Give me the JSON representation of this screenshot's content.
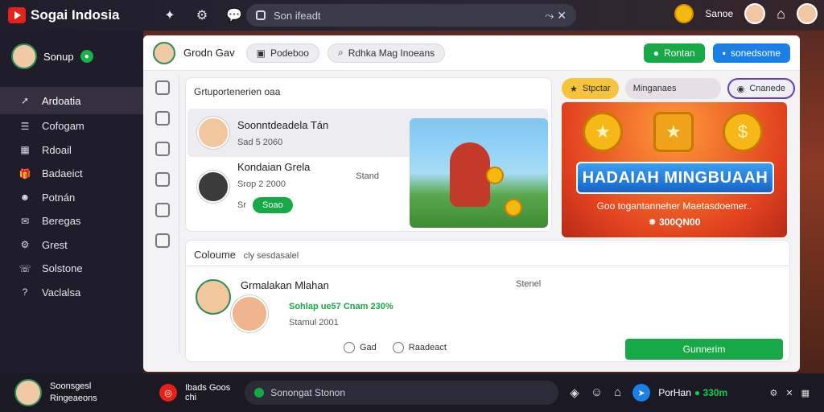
{
  "app": {
    "brand_name": "Sogai Indosia",
    "search_placeholder": "Son ifeadt",
    "coin_label": "Sanoe",
    "colors": {
      "accent_green": "#17a945",
      "accent_blue": "#1a7fe6",
      "brand_red": "#e62117"
    }
  },
  "sidebar": {
    "profile_name": "Sonup",
    "active_item": "Ardoatia",
    "items": [
      {
        "label": "Cofogam",
        "icon": "list-icon"
      },
      {
        "label": "Rdoail",
        "icon": "grid-icon"
      },
      {
        "label": "Badaeict",
        "icon": "gift-icon"
      },
      {
        "label": "Potnán",
        "icon": "user-icon"
      },
      {
        "label": "Beregas",
        "icon": "chat-icon"
      },
      {
        "label": "Grest",
        "icon": "settings-icon"
      },
      {
        "label": "Solstone",
        "icon": "phone-icon"
      },
      {
        "label": "Vaclalsa",
        "icon": "help-icon"
      }
    ]
  },
  "header": {
    "name": "Grodn Gav",
    "pill_one": "Podeboo",
    "pill_two": "Rdhka Mag Inoeans",
    "btn_green": "Rontan",
    "btn_blue": "sonedsome"
  },
  "friends_card": {
    "title": "Grtuportenerien oaa",
    "rows": [
      {
        "name": "Soonntdeadela Tán",
        "sub": "Sad 5 2060",
        "icon": "face-icon"
      },
      {
        "name": "Kondaian Grela",
        "sub": "Srop 2 2000",
        "right": "Stand",
        "button": "Soao",
        "meta": "Sr"
      }
    ]
  },
  "promo": {
    "tab_one": "Stpctar",
    "tab_two": "Minganaes",
    "tab_three": "Cnanede",
    "banner": "HADAIAH MINGBUAAH",
    "desc": "Goo togantanneher Maetasdoemer..",
    "amount": "300QN00"
  },
  "bottom_card": {
    "title": "Coloume",
    "title_muted": "cly sesdasalel",
    "name": "Grmalakan Mlahan",
    "stat": "Sohlap ue57 Cnam 230%",
    "sub": "Stamul 2001",
    "right": "Stenel",
    "action_one": "Gad",
    "action_two": "Raadeact",
    "button": "Gunnerim"
  },
  "bottombar": {
    "user_line1": "Soonsgesl",
    "user_line2": "Ringeaeons",
    "status_line1": "Ibads Goos",
    "status_line2": "chi",
    "input_placeholder": "Sonongat Stonon",
    "balance_label": "PorHan",
    "balance_value": "330m"
  }
}
